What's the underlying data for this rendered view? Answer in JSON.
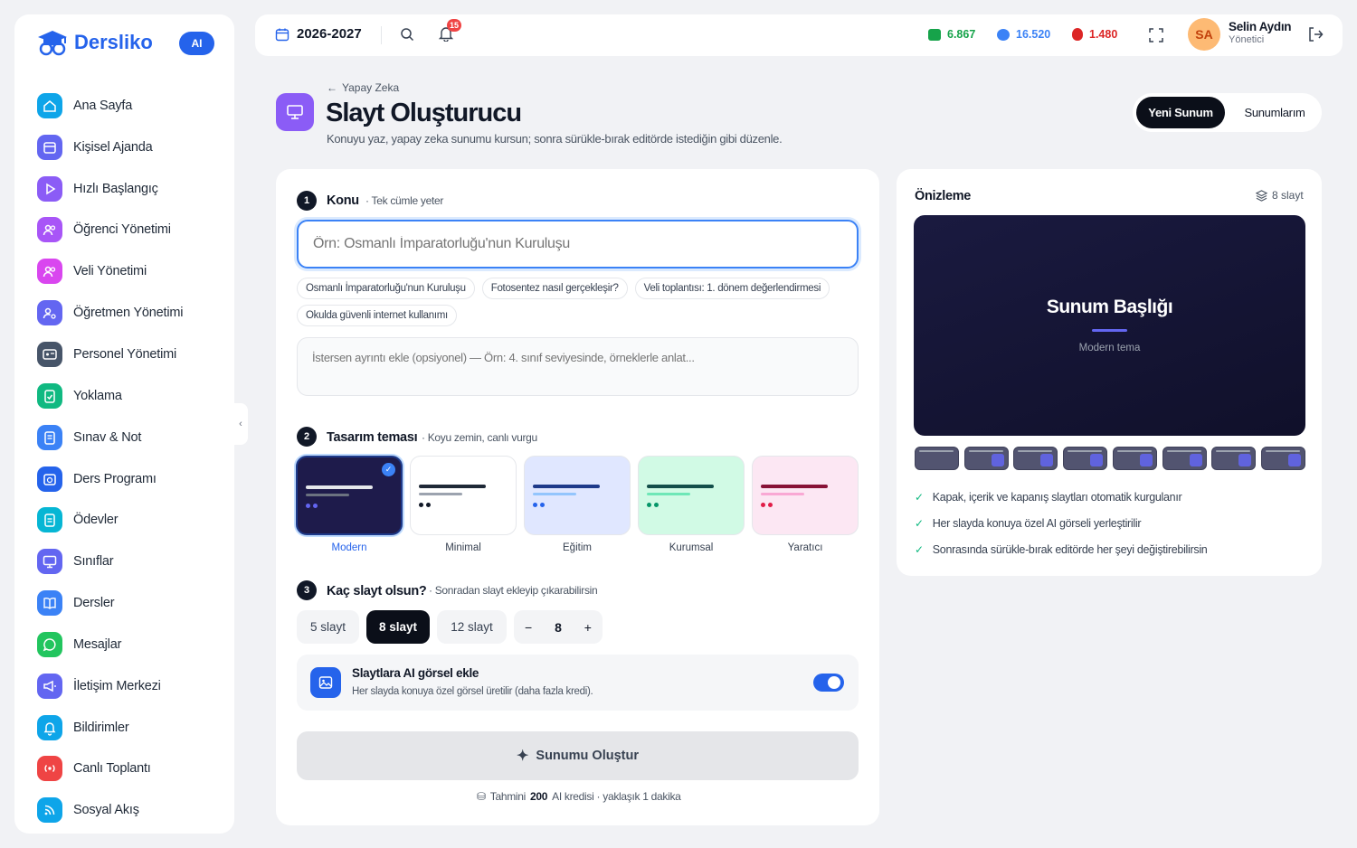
{
  "app": {
    "name": "Dersliko",
    "ai_badge": "AI"
  },
  "sidebar": {
    "items": [
      {
        "label": "Ana Sayfa",
        "icon": "home-icon",
        "color": "#0ea5e9"
      },
      {
        "label": "Kişisel Ajanda",
        "icon": "calendar-icon",
        "color": "#6366f1"
      },
      {
        "label": "Hızlı Başlangıç",
        "icon": "play-icon",
        "color": "#8b5cf6"
      },
      {
        "label": "Öğrenci Yönetimi",
        "icon": "users-icon",
        "color": "#a855f7"
      },
      {
        "label": "Veli Yönetimi",
        "icon": "users-icon",
        "color": "#d946ef"
      },
      {
        "label": "Öğretmen Yönetimi",
        "icon": "user-cog-icon",
        "color": "#6366f1"
      },
      {
        "label": "Personel Yönetimi",
        "icon": "id-card-icon",
        "color": "#475569"
      },
      {
        "label": "Yoklama",
        "icon": "clipboard-check-icon",
        "color": "#10b981"
      },
      {
        "label": "Sınav & Not",
        "icon": "exam-icon",
        "color": "#3b82f6"
      },
      {
        "label": "Ders Programı",
        "icon": "calendar-clock-icon",
        "color": "#2563eb"
      },
      {
        "label": "Ödevler",
        "icon": "clipboard-list-icon",
        "color": "#06b6d4"
      },
      {
        "label": "Sınıflar",
        "icon": "monitor-icon",
        "color": "#6366f1"
      },
      {
        "label": "Dersler",
        "icon": "book-icon",
        "color": "#3b82f6"
      },
      {
        "label": "Mesajlar",
        "icon": "chat-icon",
        "color": "#22c55e"
      },
      {
        "label": "İletişim Merkezi",
        "icon": "megaphone-icon",
        "color": "#6366f1"
      },
      {
        "label": "Bildirimler",
        "icon": "bell-icon",
        "color": "#0ea5e9"
      },
      {
        "label": "Canlı Toplantı",
        "icon": "broadcast-icon",
        "color": "#ef4444"
      },
      {
        "label": "Sosyal Akış",
        "icon": "rss-icon",
        "color": "#0ea5e9"
      }
    ]
  },
  "topbar": {
    "year": "2026-2027",
    "notification_count": "15",
    "stat_green": "6.867",
    "stat_blue": "16.520",
    "stat_red": "1.480",
    "user_initials": "SA",
    "user_name": "Selin Aydın",
    "user_role": "Yönetici"
  },
  "header": {
    "breadcrumb": "Yapay Zeka",
    "title": "Slayt Oluşturucu",
    "subtitle": "Konuyu yaz, yapay zeka sunumu kursun; sonra sürükle-bırak editörde istediğin gibi düzenle.",
    "tab_new": "Yeni Sunum",
    "tab_list": "Sunumlarım"
  },
  "form": {
    "step1": {
      "num": "1",
      "title": "Konu",
      "sub": "· Tek cümle yeter",
      "placeholder": "Örn: Osmanlı İmparatorluğu'nun Kuruluşu",
      "suggestions": [
        "Osmanlı İmparatorluğu'nun Kuruluşu",
        "Fotosentez nasıl gerçekleşir?",
        "Veli toplantısı: 1. dönem değerlendirmesi",
        "Okulda güvenli internet kullanımı"
      ],
      "detail_placeholder": "İstersen ayrıntı ekle (opsiyonel) — Örn: 4. sınıf seviyesinde, örneklerle anlat..."
    },
    "step2": {
      "num": "2",
      "title": "Tasarım teması",
      "sub": "· Koyu zemin, canlı vurgu",
      "themes": [
        "Modern",
        "Minimal",
        "Eğitim",
        "Kurumsal",
        "Yaratıcı"
      ],
      "selected": "Modern"
    },
    "step3": {
      "num": "3",
      "title": "Kaç slayt olsun?",
      "sub": "· Sonradan slayt ekleyip çıkarabilirsin",
      "options": [
        "5 slayt",
        "8 slayt",
        "12 slayt"
      ],
      "selected": "8 slayt",
      "stepper_value": "8",
      "minus": "−",
      "plus": "+"
    },
    "ai_image": {
      "title": "Slaytlara AI görsel ekle",
      "desc": "Her slayda konuya özel görsel üretilir (daha fazla kredi).",
      "enabled": true
    },
    "submit_label": "Sunumu Oluştur",
    "cost": {
      "prefix": "Tahmini",
      "amount": "200",
      "suffix": "AI kredisi · yaklaşık 1 dakika"
    }
  },
  "preview": {
    "title": "Önizleme",
    "count": "8 slayt",
    "slide_title": "Sunum Başlığı",
    "slide_sub": "Modern tema",
    "features": [
      "Kapak, içerik ve kapanış slaytları otomatik kurgulanır",
      "Her slayda konuya özel AI görseli yerleştirilir",
      "Sonrasında sürükle-bırak editörde her şeyi değiştirebilirsin"
    ]
  },
  "colors": {
    "accent": "#2563eb",
    "brand_purple": "#8b5cf6",
    "dark": "#111827"
  }
}
